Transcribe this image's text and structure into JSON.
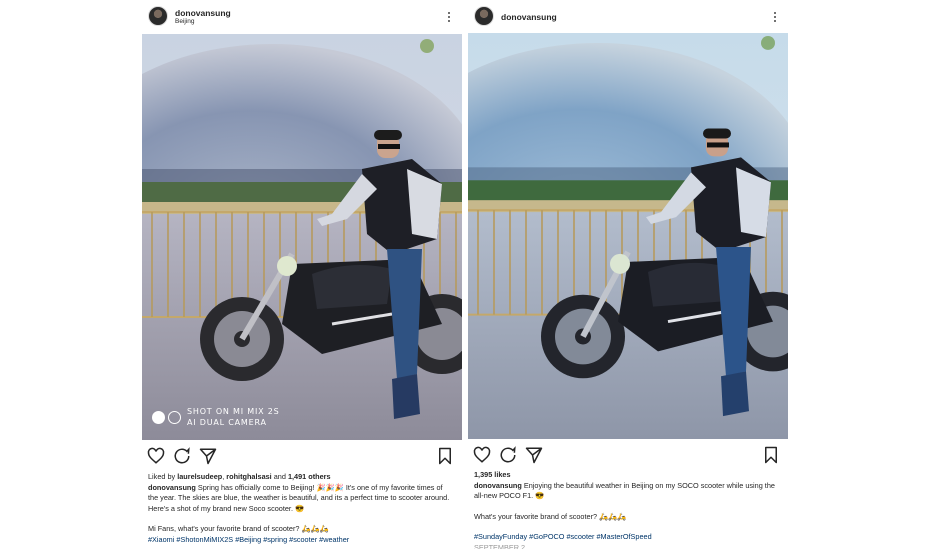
{
  "colors": {
    "hashtag": "#003569",
    "text": "#262626",
    "icon": "#262626"
  },
  "left_post": {
    "username": "donovansung",
    "location": "Beijing",
    "watermark": {
      "line1": "SHOT ON MI MIX 2S",
      "line2": "AI DUAL CAMERA"
    },
    "liked_by_prefix": "Liked by ",
    "liked_by_user": "laurelsudeep",
    "liked_by_sep": ", ",
    "liked_by_user2": "rohitghalsasi",
    "liked_by_mid": " and ",
    "liked_by_others": "1,491 others",
    "caption_user": "donovansung",
    "caption_text": " Spring has officially come to Beijing! 🎉🎉🎉 It's one of my favorite times of the year. The skies are blue, the weather is beautiful, and its a perfect time to scooter around. Here's a shot of my brand new Soco scooter. 😎",
    "question": "Mi Fans, what's your favorite brand of scooter? 🛵🛵🛵",
    "hashtags": "#Xiaomi #ShotonMiMIX2S #Beijing #spring #scooter #weather"
  },
  "right_post": {
    "username": "donovansung",
    "likes": "1,395 likes",
    "caption_user": "donovansung",
    "caption_text": " Enjoying the beautiful weather in Beijing on my SOCO scooter while using the all-new POCO F1. 😎",
    "question": "What's your favorite brand of scooter? 🛵🛵🛵",
    "hashtags": "#SundayFunday #GoPOCO #scooter #MasterOfSpeed",
    "truncated_line": "SEPTEMBER 2"
  },
  "icons": {
    "like": "heart-icon",
    "comment": "comment-icon",
    "share": "send-icon",
    "save": "bookmark-icon",
    "more": "more-vertical-icon"
  }
}
